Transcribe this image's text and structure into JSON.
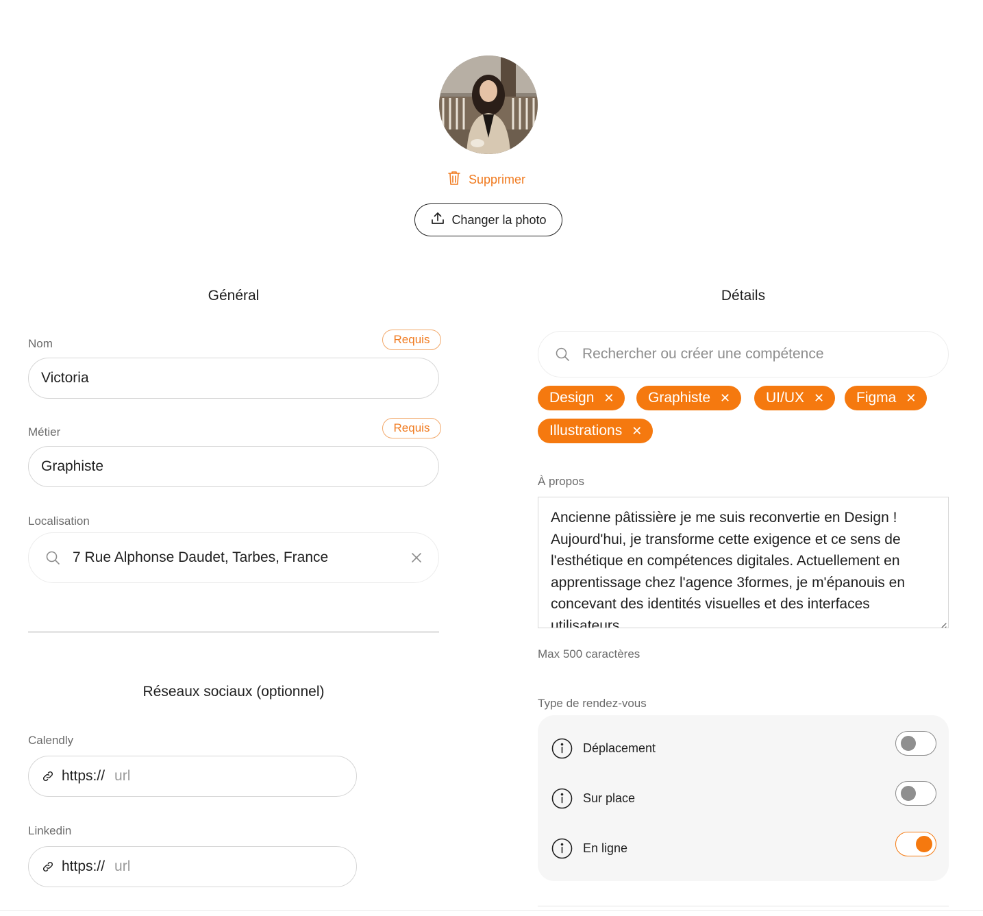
{
  "profile_photo": {
    "delete_label": "Supprimer",
    "change_label": "Changer la photo"
  },
  "general": {
    "title": "Général",
    "name": {
      "label": "Nom",
      "badge": "Requis",
      "value": "Victoria"
    },
    "job": {
      "label": "Métier",
      "badge": "Requis",
      "value": "Graphiste"
    },
    "location": {
      "label": "Localisation",
      "value": "7 Rue Alphonse Daudet, Tarbes, France"
    }
  },
  "social": {
    "title": "Réseaux sociaux (optionnel)",
    "calendly": {
      "label": "Calendly",
      "prefix": "https://",
      "placeholder": "url"
    },
    "linkedin": {
      "label": "Linkedin",
      "prefix": "https://",
      "placeholder": "url"
    }
  },
  "details": {
    "title": "Détails",
    "skill_search_placeholder": "Rechercher ou créer une compétence",
    "skills": [
      "Design",
      "Graphiste",
      "UI/UX",
      "Figma",
      "Illustrations"
    ],
    "about": {
      "label": "À propos",
      "text": "Ancienne pâtissière je me suis reconvertie en Design ! Aujourd'hui, je transforme cette exigence et ce sens de l'esthétique en compétences digitales. Actuellement en apprentissage chez l'agence 3formes, je m'épanouis en concevant des identités visuelles et des interfaces utilisateurs.",
      "hint": "Max 500 caractères"
    },
    "appointment": {
      "label": "Type de rendez-vous",
      "options": [
        {
          "label": "Déplacement",
          "enabled": false
        },
        {
          "label": "Sur place",
          "enabled": false
        },
        {
          "label": "En ligne",
          "enabled": true
        }
      ]
    }
  },
  "colors": {
    "accent": "#f5790f",
    "accent_text": "#f07a1f",
    "badge_border": "#f2a86a"
  }
}
